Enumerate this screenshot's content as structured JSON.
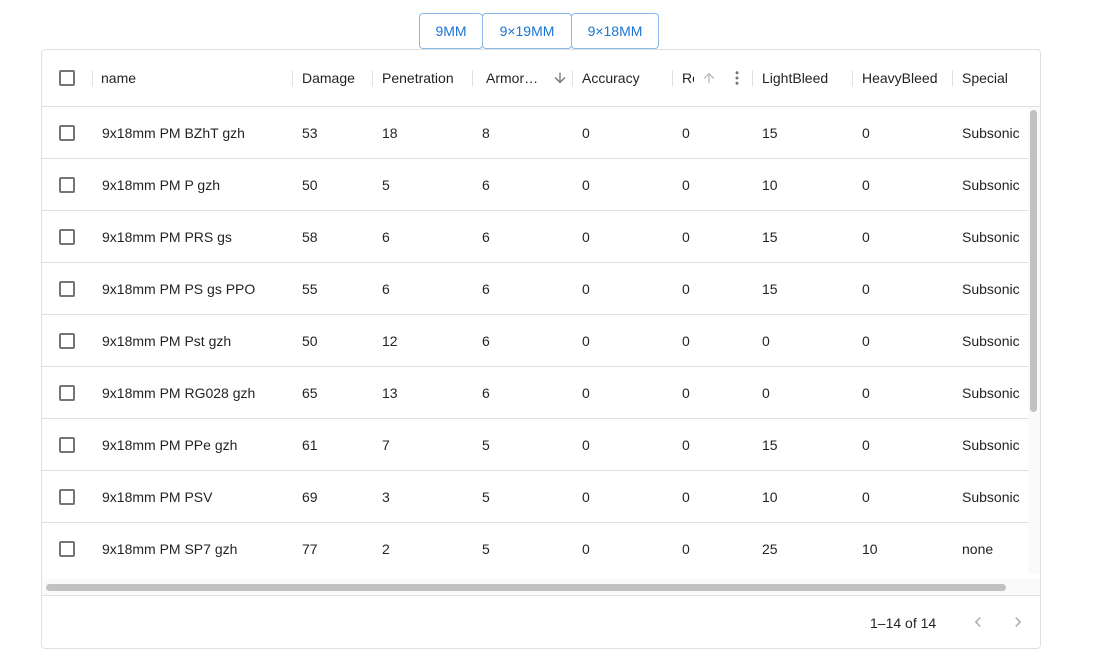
{
  "toggle_buttons": [
    "9MM",
    "9×19MM",
    "9×18MM"
  ],
  "columns": [
    "name",
    "Damage",
    "Penetration",
    "Armor…",
    "Accuracy",
    "Re",
    "LightBleed",
    "HeavyBleed",
    "Special"
  ],
  "rows": [
    [
      "9x18mm PM BZhT gzh",
      "53",
      "18",
      "8",
      "0",
      "0",
      "15",
      "0",
      "Subsonic"
    ],
    [
      "9x18mm PM P gzh",
      "50",
      "5",
      "6",
      "0",
      "0",
      "10",
      "0",
      "Subsonic"
    ],
    [
      "9x18mm PM PRS gs",
      "58",
      "6",
      "6",
      "0",
      "0",
      "15",
      "0",
      "Subsonic"
    ],
    [
      "9x18mm PM PS gs PPO",
      "55",
      "6",
      "6",
      "0",
      "0",
      "15",
      "0",
      "Subsonic"
    ],
    [
      "9x18mm PM Pst gzh",
      "50",
      "12",
      "6",
      "0",
      "0",
      "0",
      "0",
      "Subsonic"
    ],
    [
      "9x18mm PM RG028 gzh",
      "65",
      "13",
      "6",
      "0",
      "0",
      "0",
      "0",
      "Subsonic"
    ],
    [
      "9x18mm PM PPe gzh",
      "61",
      "7",
      "5",
      "0",
      "0",
      "15",
      "0",
      "Subsonic"
    ],
    [
      "9x18mm PM PSV",
      "69",
      "3",
      "5",
      "0",
      "0",
      "10",
      "0",
      "Subsonic"
    ],
    [
      "9x18mm PM SP7 gzh",
      "77",
      "2",
      "5",
      "0",
      "0",
      "25",
      "10",
      "none"
    ]
  ],
  "pagination": {
    "text": "1–14 of 14"
  },
  "icons": {
    "sort_desc": "arrow-down-icon",
    "sort_asc": "arrow-up-icon",
    "menu": "more-vert-icon",
    "prev": "chevron-left-icon",
    "next": "chevron-right-icon"
  },
  "colors": {
    "accent": "#1976d2",
    "border": "#e0e0e0"
  }
}
